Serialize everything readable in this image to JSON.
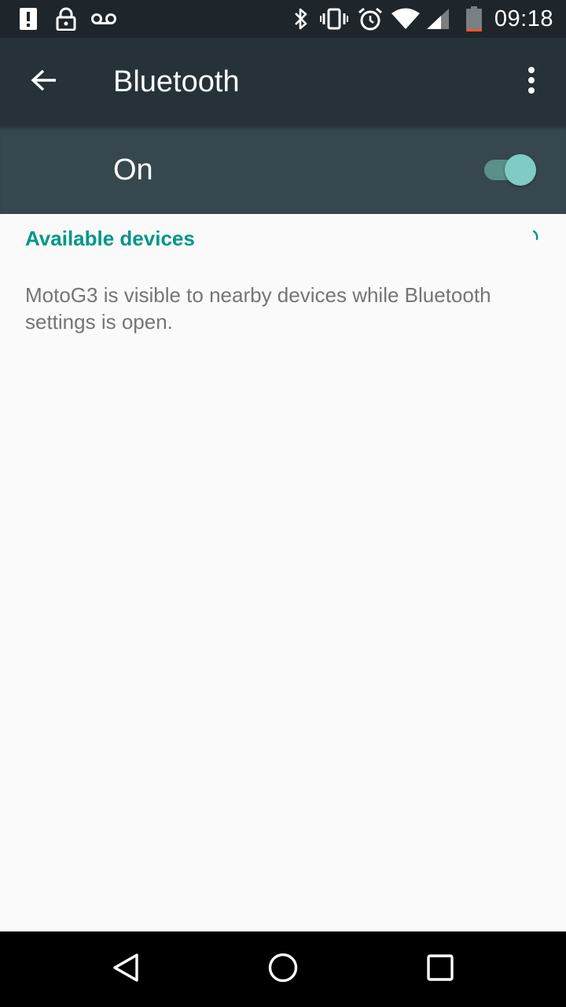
{
  "status_bar": {
    "time": "09:18",
    "icons": [
      "alert-icon",
      "lock-icon",
      "voicemail-icon",
      "bluetooth-icon",
      "vibrate-icon",
      "alarm-icon",
      "wifi-icon",
      "cell-signal-icon",
      "battery-icon"
    ],
    "battery_level": 0.1,
    "colors": {
      "background": "#1e252b",
      "battery_low": "#ff5722"
    }
  },
  "app_bar": {
    "title": "Bluetooth",
    "back_icon": "arrow-back-icon",
    "overflow_icon": "more-vert-icon",
    "color": "#263238"
  },
  "bluetooth_switch": {
    "label": "On",
    "checked": true,
    "color": "#37474f",
    "accent": "#80cbc4"
  },
  "devices": {
    "section_title": "Available devices",
    "visibility_message": "MotoG3 is visible to nearby devices while Bluetooth settings is open.",
    "accent": "#009688"
  },
  "nav_bar": {
    "buttons": [
      "back-triangle-icon",
      "home-circle-icon",
      "recents-square-icon"
    ]
  }
}
